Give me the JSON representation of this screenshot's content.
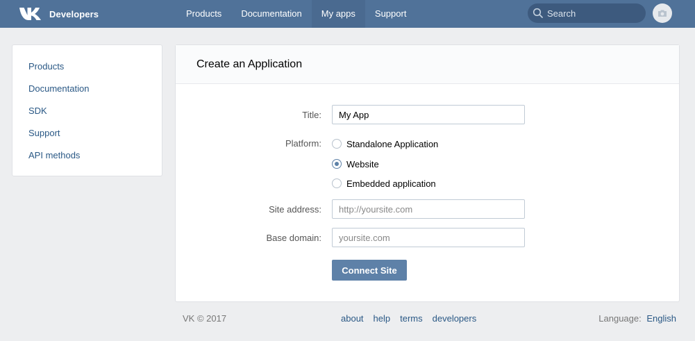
{
  "header": {
    "brand": "Developers",
    "nav": [
      {
        "label": "Products",
        "active": false
      },
      {
        "label": "Documentation",
        "active": false
      },
      {
        "label": "My apps",
        "active": true
      },
      {
        "label": "Support",
        "active": false
      }
    ],
    "search_placeholder": "Search",
    "icons": {
      "logo": "vk-logo-icon",
      "search": "search-icon",
      "avatar": "camera-icon"
    },
    "colors": {
      "bar": "#507299",
      "active_tab": "#4a6a90",
      "search_bg": "#3d5a7e"
    }
  },
  "sidebar": {
    "items": [
      {
        "label": "Products"
      },
      {
        "label": "Documentation"
      },
      {
        "label": "SDK"
      },
      {
        "label": "Support"
      },
      {
        "label": "API methods"
      }
    ]
  },
  "main": {
    "title": "Create an Application",
    "form": {
      "title_label": "Title:",
      "title_value": "My App",
      "platform_label": "Platform:",
      "platform_options": [
        {
          "label": "Standalone Application",
          "checked": false
        },
        {
          "label": "Website",
          "checked": true
        },
        {
          "label": "Embedded application",
          "checked": false
        }
      ],
      "site_address_label": "Site address:",
      "site_address_placeholder": "http://yoursite.com",
      "base_domain_label": "Base domain:",
      "base_domain_placeholder": "yoursite.com",
      "submit_label": "Connect Site"
    }
  },
  "footer": {
    "copyright": "VK © 2017",
    "links": [
      {
        "label": "about"
      },
      {
        "label": "help"
      },
      {
        "label": "terms"
      },
      {
        "label": "developers"
      }
    ],
    "language_label": "Language:",
    "language_value": "English"
  },
  "colors": {
    "link": "#2a5885",
    "button": "#5e81a8",
    "page_bg": "#edeef0"
  }
}
